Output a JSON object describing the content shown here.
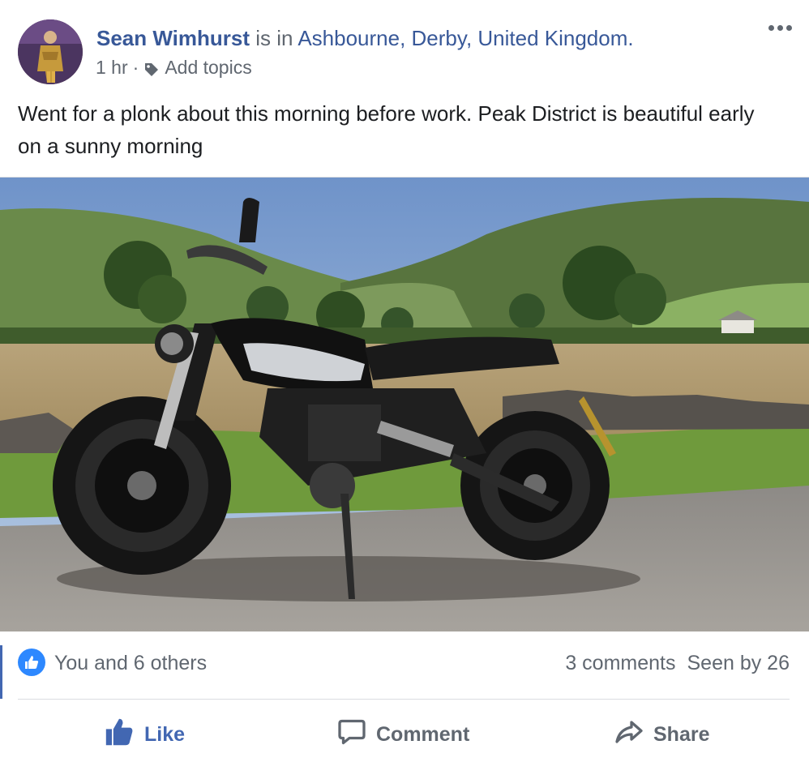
{
  "post": {
    "author": "Sean Wimhurst",
    "is_in": "is in",
    "location": "Ashbourne, Derby, United Kingdom.",
    "time": "1 hr",
    "separator": "·",
    "add_topics": "Add topics",
    "body": "Went for a plonk about this morning before work. Peak District is beautiful early on a sunny morning"
  },
  "stats": {
    "likes": "You and 6 others",
    "comments": "3 comments",
    "seen_by": "Seen by 26"
  },
  "actions": {
    "like": "Like",
    "comment": "Comment",
    "share": "Share"
  },
  "colors": {
    "link": "#385898",
    "like_blue": "#4267b2",
    "badge_blue": "#2d88ff",
    "muted": "#606770"
  },
  "icons": [
    "more-options-icon",
    "tag-icon",
    "like-badge-icon",
    "like-thumb-icon",
    "comment-bubble-icon",
    "share-arrow-icon"
  ]
}
